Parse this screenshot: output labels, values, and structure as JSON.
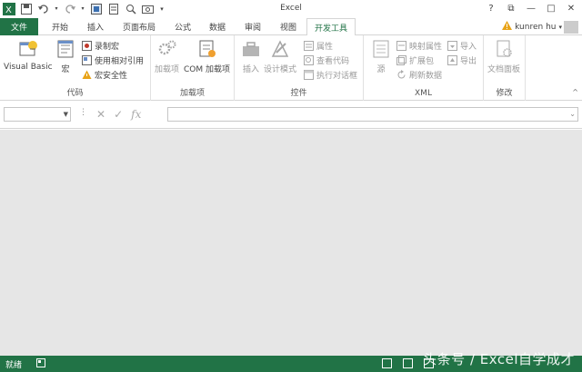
{
  "window": {
    "title": "Excel",
    "buttons": {
      "help": "?",
      "restore": "⧉",
      "minimize": "—",
      "maximize": "□",
      "close": "✕"
    }
  },
  "tabs": {
    "file": "文件",
    "items": [
      "开始",
      "插入",
      "页面布局",
      "公式",
      "数据",
      "审阅",
      "视图",
      "开发工具"
    ],
    "active": "开发工具"
  },
  "user": {
    "name": "kunren hu",
    "dropdown": "▾"
  },
  "ribbon": {
    "code": {
      "label": "代码",
      "visual_basic": "Visual Basic",
      "macros": "宏",
      "record_macro": "录制宏",
      "relative_refs": "使用相对引用",
      "macro_security": "宏安全性"
    },
    "addins": {
      "label": "加载项",
      "addins": "加载项",
      "com_addins": "COM 加载项"
    },
    "controls": {
      "label": "控件",
      "insert": "插入",
      "design_mode": "设计模式",
      "properties": "属性",
      "view_code": "查看代码",
      "run_dialog": "执行对话框"
    },
    "xml": {
      "label": "XML",
      "source": "源",
      "map_properties": "映射属性",
      "expansion_packs": "扩展包",
      "refresh_data": "刷新数据",
      "import": "导入",
      "export": "导出"
    },
    "modify": {
      "label": "修改",
      "document_panel": "文档面板"
    },
    "collapse": "^"
  },
  "formula_bar": {
    "name_box_value": "",
    "dots": "⋮",
    "cancel": "✕",
    "enter": "✓",
    "fx": "fx",
    "formula_value": ""
  },
  "status_bar": {
    "ready": "就绪"
  },
  "watermark": "头条号 / Excel自学成才",
  "colors": {
    "accent": "#217346",
    "workspace": "#e6e6e6"
  }
}
